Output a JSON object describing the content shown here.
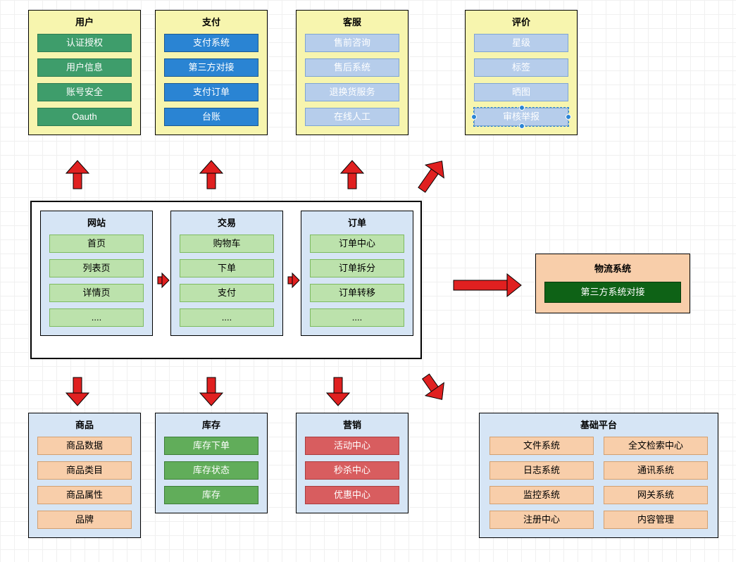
{
  "top": {
    "user": {
      "title": "用户",
      "items": [
        "认证授权",
        "用户信息",
        "账号安全",
        "Oauth"
      ]
    },
    "pay": {
      "title": "支付",
      "items": [
        "支付系统",
        "第三方对接",
        "支付订单",
        "台账"
      ]
    },
    "cs": {
      "title": "客服",
      "items": [
        "售前咨询",
        "售后系统",
        "退换货服务",
        "在线人工"
      ]
    },
    "review": {
      "title": "评价",
      "items": [
        "星级",
        "标签",
        "晒图",
        "审核举报"
      ]
    }
  },
  "core": {
    "site": {
      "title": "网站",
      "items": [
        "首页",
        "列表页",
        "详情页",
        "...."
      ]
    },
    "trade": {
      "title": "交易",
      "items": [
        "购物车",
        "下单",
        "支付",
        "...."
      ]
    },
    "order": {
      "title": "订单",
      "items": [
        "订单中心",
        "订单拆分",
        "订单转移",
        "...."
      ]
    }
  },
  "logistics": {
    "title": "物流系统",
    "items": [
      "第三方系统对接"
    ]
  },
  "bottom": {
    "goods": {
      "title": "商品",
      "items": [
        "商品数据",
        "商品类目",
        "商品属性",
        "品牌"
      ]
    },
    "stock": {
      "title": "库存",
      "items": [
        "库存下单",
        "库存状态",
        "库存"
      ]
    },
    "market": {
      "title": "营销",
      "items": [
        "活动中心",
        "秒杀中心",
        "优惠中心"
      ]
    }
  },
  "platform": {
    "title": "基础平台",
    "left": [
      "文件系统",
      "日志系统",
      "监控系统",
      "注册中心"
    ],
    "right": [
      "全文检索中心",
      "通讯系统",
      "网关系统",
      "内容管理"
    ]
  }
}
